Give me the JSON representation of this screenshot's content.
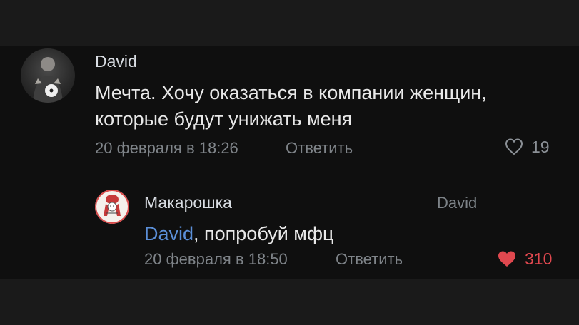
{
  "comment": {
    "author": "David",
    "text_line1": "Мечта. Хочу оказаться в компании женщин,",
    "text_line2": "которые будут унижать меня",
    "date": "20 февраля в 18:26",
    "reply_label": "Ответить",
    "likes": "19",
    "liked": false
  },
  "reply": {
    "author": "Макарошка",
    "reply_to": "David",
    "mention": "David",
    "text_rest": ", попробуй мфц",
    "date": "20 февраля в 18:50",
    "reply_label": "Ответить",
    "likes": "310",
    "liked": true,
    "like_color": "#e0484f"
  },
  "colors": {
    "background": "#0f0f0f",
    "mention": "#5b8fd8",
    "meta": "#7f8489"
  }
}
